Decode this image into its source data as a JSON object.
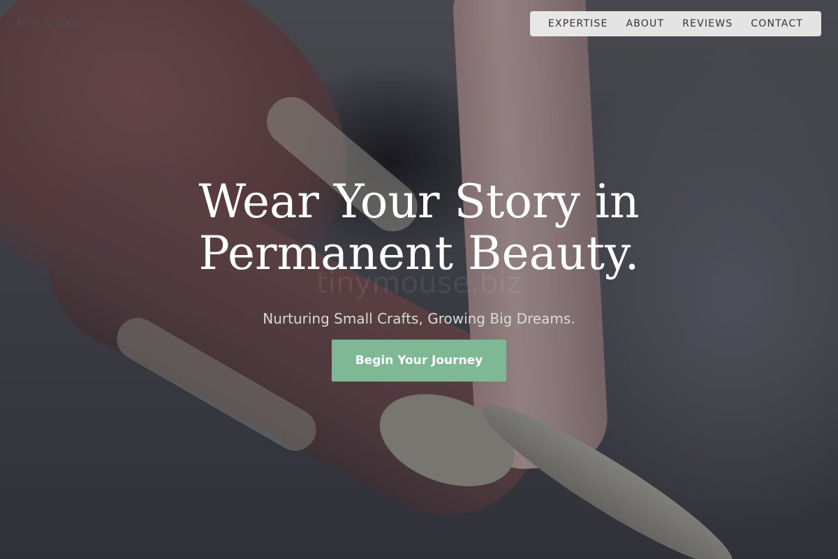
{
  "brand": {
    "name": "Ink Artisan"
  },
  "nav": {
    "items": [
      {
        "label": "EXPERTISE"
      },
      {
        "label": "ABOUT"
      },
      {
        "label": "REVIEWS"
      },
      {
        "label": "CONTACT"
      }
    ]
  },
  "hero": {
    "title_line1": "Wear Your Story in",
    "title_line2": "Permanent Beauty.",
    "subtitle": "Nurturing Small Crafts, Growing Big Dreams.",
    "watermark": "tinymouse.biz",
    "cta_label": "Begin Your Journey",
    "cta_color": "#7fb895"
  }
}
